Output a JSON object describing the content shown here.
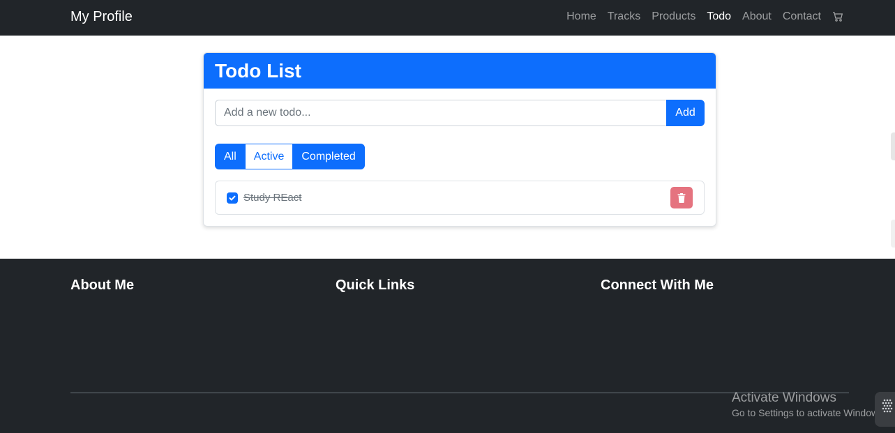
{
  "navbar": {
    "brand": "My Profile",
    "links": [
      {
        "label": "Home",
        "active": false
      },
      {
        "label": "Tracks",
        "active": false
      },
      {
        "label": "Products",
        "active": false
      },
      {
        "label": "Todo",
        "active": true
      },
      {
        "label": "About",
        "active": false
      },
      {
        "label": "Contact",
        "active": false
      }
    ],
    "cart_icon": "cart-icon"
  },
  "todo": {
    "title": "Todo List",
    "input": {
      "value": "",
      "placeholder": "Add a new todo..."
    },
    "add_label": "Add",
    "filters": [
      {
        "label": "All",
        "selected": true
      },
      {
        "label": "Active",
        "selected": false
      },
      {
        "label": "Completed",
        "selected": true
      }
    ],
    "items": [
      {
        "text": "Study REact",
        "completed": true
      }
    ],
    "delete_icon": "trash-icon"
  },
  "footer": {
    "headings": [
      "About Me",
      "Quick Links",
      "Connect With Me"
    ]
  },
  "watermark": {
    "title": "Activate Windows",
    "subtitle": "Go to Settings to activate Windows."
  },
  "colors": {
    "primary": "#0d6efd",
    "dark": "#212529",
    "danger_faded": "#e5737f"
  }
}
